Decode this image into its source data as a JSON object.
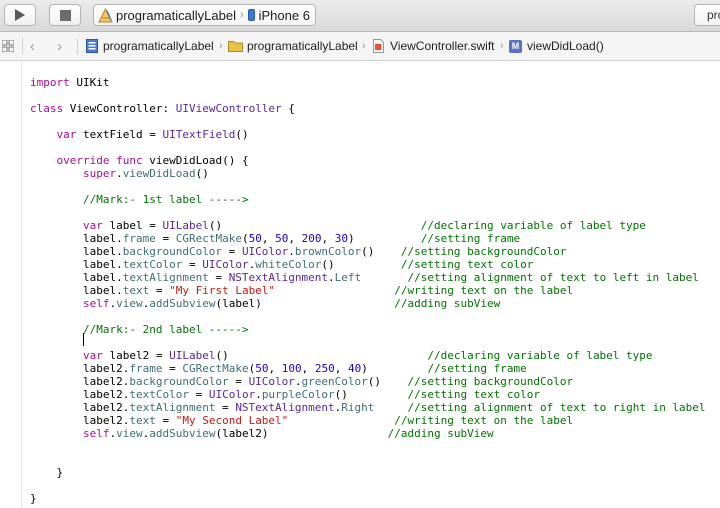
{
  "toolbar": {
    "scheme": "programaticallyLabel",
    "device": "iPhone 6",
    "status": "pro"
  },
  "jumpbar": {
    "crumbs": [
      {
        "label": "programaticallyLabel",
        "icon": "project-icon"
      },
      {
        "label": "programaticallyLabel",
        "icon": "folder-icon"
      },
      {
        "label": "ViewController.swift",
        "icon": "swift-file-icon"
      },
      {
        "label": "viewDidLoad()",
        "icon": "method-icon"
      }
    ]
  },
  "colors": {
    "keyword": "#aa0d91",
    "type": "#5c2699",
    "property": "#3f6e74",
    "comment": "#007400",
    "string": "#c41a16",
    "number": "#1c00cf"
  },
  "code": {
    "lines": [
      [
        [
          "kw",
          "import"
        ],
        [
          "p",
          " UIKit"
        ]
      ],
      [],
      [
        [
          "kw",
          "class"
        ],
        [
          "p",
          " ViewController: "
        ],
        [
          "ty",
          "UIViewController"
        ],
        [
          "p",
          " {"
        ]
      ],
      [],
      [
        [
          "p",
          "    "
        ],
        [
          "kw",
          "var"
        ],
        [
          "p",
          " textField = "
        ],
        [
          "ty",
          "UITextField"
        ],
        [
          "p",
          "()"
        ]
      ],
      [],
      [
        [
          "p",
          "    "
        ],
        [
          "kw",
          "override"
        ],
        [
          "p",
          " "
        ],
        [
          "kw",
          "func"
        ],
        [
          "p",
          " viewDidLoad() {"
        ]
      ],
      [
        [
          "p",
          "        "
        ],
        [
          "kw",
          "super"
        ],
        [
          "p",
          "."
        ],
        [
          "pf",
          "viewDidLoad"
        ],
        [
          "p",
          "()"
        ]
      ],
      [],
      [
        [
          "p",
          "        "
        ],
        [
          "cm",
          "//Mark:- 1st label ----->"
        ]
      ],
      [],
      [
        [
          "p",
          "        "
        ],
        [
          "kw",
          "var"
        ],
        [
          "p",
          " label = "
        ],
        [
          "ty",
          "UILabel"
        ],
        [
          "p",
          "()                              "
        ],
        [
          "cm",
          "//declaring variable of label type"
        ]
      ],
      [
        [
          "p",
          "        label."
        ],
        [
          "pf",
          "frame"
        ],
        [
          "p",
          " = "
        ],
        [
          "pf",
          "CGRectMake"
        ],
        [
          "p",
          "("
        ],
        [
          "nm",
          "50"
        ],
        [
          "p",
          ", "
        ],
        [
          "nm",
          "50"
        ],
        [
          "p",
          ", "
        ],
        [
          "nm",
          "200"
        ],
        [
          "p",
          ", "
        ],
        [
          "nm",
          "30"
        ],
        [
          "p",
          ")          "
        ],
        [
          "cm",
          "//setting frame"
        ]
      ],
      [
        [
          "p",
          "        label."
        ],
        [
          "pf",
          "backgroundColor"
        ],
        [
          "p",
          " = "
        ],
        [
          "ty",
          "UIColor"
        ],
        [
          "p",
          "."
        ],
        [
          "pf",
          "brownColor"
        ],
        [
          "p",
          "()    "
        ],
        [
          "cm",
          "//setting backgroundColor"
        ]
      ],
      [
        [
          "p",
          "        label."
        ],
        [
          "pf",
          "textColor"
        ],
        [
          "p",
          " = "
        ],
        [
          "ty",
          "UIColor"
        ],
        [
          "p",
          "."
        ],
        [
          "pf",
          "whiteColor"
        ],
        [
          "p",
          "()          "
        ],
        [
          "cm",
          "//setting text color"
        ]
      ],
      [
        [
          "p",
          "        label."
        ],
        [
          "pf",
          "textAlignment"
        ],
        [
          "p",
          " = "
        ],
        [
          "ty",
          "NSTextAlignment"
        ],
        [
          "p",
          "."
        ],
        [
          "pf",
          "Left"
        ],
        [
          "p",
          "       "
        ],
        [
          "cm",
          "//setting alignment of text to left in label"
        ]
      ],
      [
        [
          "p",
          "        label."
        ],
        [
          "pf",
          "text"
        ],
        [
          "p",
          " = "
        ],
        [
          "st",
          "\"My First Label\""
        ],
        [
          "p",
          "                  "
        ],
        [
          "cm",
          "//writing text on the label"
        ]
      ],
      [
        [
          "p",
          "        "
        ],
        [
          "kw",
          "self"
        ],
        [
          "p",
          "."
        ],
        [
          "pf",
          "view"
        ],
        [
          "p",
          "."
        ],
        [
          "pf",
          "addSubview"
        ],
        [
          "p",
          "(label)                    "
        ],
        [
          "cm",
          "//adding subView"
        ]
      ],
      [],
      [
        [
          "p",
          "        "
        ],
        [
          "cm",
          "//Mark:- 2nd label ----->"
        ]
      ],
      [],
      [
        [
          "p",
          "        "
        ],
        [
          "kw",
          "var"
        ],
        [
          "p",
          " label2 = "
        ],
        [
          "ty",
          "UILabel"
        ],
        [
          "p",
          "()                              "
        ],
        [
          "cm",
          "//declaring variable of label type"
        ]
      ],
      [
        [
          "p",
          "        label2."
        ],
        [
          "pf",
          "frame"
        ],
        [
          "p",
          " = "
        ],
        [
          "pf",
          "CGRectMake"
        ],
        [
          "p",
          "("
        ],
        [
          "nm",
          "50"
        ],
        [
          "p",
          ", "
        ],
        [
          "nm",
          "100"
        ],
        [
          "p",
          ", "
        ],
        [
          "nm",
          "250"
        ],
        [
          "p",
          ", "
        ],
        [
          "nm",
          "40"
        ],
        [
          "p",
          ")         "
        ],
        [
          "cm",
          "//setting frame"
        ]
      ],
      [
        [
          "p",
          "        label2."
        ],
        [
          "pf",
          "backgroundColor"
        ],
        [
          "p",
          " = "
        ],
        [
          "ty",
          "UIColor"
        ],
        [
          "p",
          "."
        ],
        [
          "pf",
          "greenColor"
        ],
        [
          "p",
          "()    "
        ],
        [
          "cm",
          "//setting backgroundColor"
        ]
      ],
      [
        [
          "p",
          "        label2."
        ],
        [
          "pf",
          "textColor"
        ],
        [
          "p",
          " = "
        ],
        [
          "ty",
          "UIColor"
        ],
        [
          "p",
          "."
        ],
        [
          "pf",
          "purpleColor"
        ],
        [
          "p",
          "()         "
        ],
        [
          "cm",
          "//setting text color"
        ]
      ],
      [
        [
          "p",
          "        label2."
        ],
        [
          "pf",
          "textAlignment"
        ],
        [
          "p",
          " = "
        ],
        [
          "ty",
          "NSTextAlignment"
        ],
        [
          "p",
          "."
        ],
        [
          "pf",
          "Right"
        ],
        [
          "p",
          "     "
        ],
        [
          "cm",
          "//setting alignment of text to right in label"
        ]
      ],
      [
        [
          "p",
          "        label2."
        ],
        [
          "pf",
          "text"
        ],
        [
          "p",
          " = "
        ],
        [
          "st",
          "\"My Second Label\""
        ],
        [
          "p",
          "                "
        ],
        [
          "cm",
          "//writing text on the label"
        ]
      ],
      [
        [
          "p",
          "        "
        ],
        [
          "kw",
          "self"
        ],
        [
          "p",
          "."
        ],
        [
          "pf",
          "view"
        ],
        [
          "p",
          "."
        ],
        [
          "pf",
          "addSubview"
        ],
        [
          "p",
          "(label2)                  "
        ],
        [
          "cm",
          "//adding subView"
        ]
      ],
      [],
      [],
      [
        [
          "p",
          "    }"
        ]
      ],
      [],
      [
        [
          "p",
          "}"
        ]
      ]
    ]
  }
}
